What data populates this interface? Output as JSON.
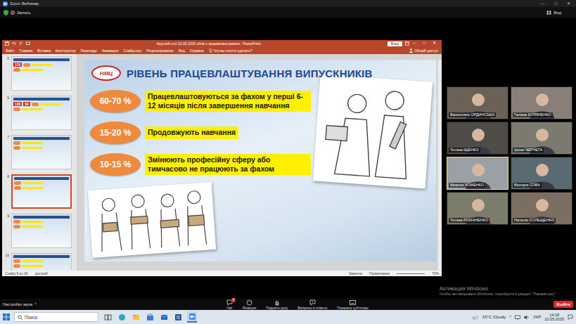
{
  "window": {
    "title": "Zoom Вебинар",
    "controls": [
      "—",
      "□",
      "✕"
    ]
  },
  "topbar": {
    "recording": "Запись",
    "view": "Вид"
  },
  "ppt": {
    "title": "Круглий стіл 22.05.2025 облік з працевлаштування - PowerPoint",
    "login": "Вход",
    "controls": [
      "—",
      "□",
      "✕"
    ],
    "menu": [
      "Файл",
      "Главная",
      "Вставка",
      "Конструктор",
      "Переходы",
      "Анимация",
      "Слайд-шоу",
      "Рецензирование",
      "Вид",
      "Справка"
    ],
    "search": "Что вы хотите сделать?",
    "share": "Общий доступ",
    "thumbnails": [
      {
        "number": "5",
        "selected": false,
        "texts": [
          "170"
        ]
      },
      {
        "number": "6",
        "selected": false,
        "texts": [
          "130",
          "69"
        ]
      },
      {
        "number": "7",
        "selected": false,
        "texts": []
      },
      {
        "number": "8",
        "selected": true,
        "texts": []
      },
      {
        "number": "9",
        "selected": false,
        "texts": []
      },
      {
        "number": "10",
        "selected": false,
        "texts": []
      }
    ],
    "slide": {
      "logo": "НМЦ",
      "title": "РІВЕНЬ ПРАЦЕВЛАШТУВАННЯ ВИПУСКНИКІВ",
      "rows": [
        {
          "value": "60-70 %",
          "text": "Працевлаштовуються за фахом у перші 6-12 місяців після завершення навчання"
        },
        {
          "value": "15-20 %",
          "text": "Продовжують навчання"
        },
        {
          "value": "10-15 %",
          "text": "Змінюють професійну сферу або тимчасово не працюють за фахом"
        }
      ]
    },
    "status": {
      "slide": "Слайд 8 из 26",
      "lang": "русский",
      "notes": "Заметки",
      "comments": "Примечания",
      "zoom": "73%"
    }
  },
  "participants": [
    {
      "name": "Валентина ОРДИНСЬКА",
      "active": false
    },
    {
      "name": "Галина КУЛЯНЕНКО",
      "active": false
    },
    {
      "name": "Тетяна ІЩЕНКО",
      "active": false
    },
    {
      "name": "Ірина ЧЕРНЕГА",
      "active": false
    },
    {
      "name": "Микола ХОМЕНКО",
      "active": true
    },
    {
      "name": "Вікторія СОВА",
      "active": false
    },
    {
      "name": "Тетяна РОМАНЕНКО",
      "active": false
    },
    {
      "name": "Наталія СОЛЕЩЕНКО",
      "active": false
    }
  ],
  "toolbar": {
    "audio": "Настройки звука",
    "caret": "^",
    "items": [
      {
        "label": "Чат",
        "badge": "9"
      },
      {
        "label": "Реакции",
        "badge": ""
      },
      {
        "label": "Поднять руку",
        "badge": ""
      },
      {
        "label": "Вопросы и ответы",
        "badge": ""
      },
      {
        "label": "Показать субтитры",
        "badge": ""
      }
    ],
    "leave": "Выйти"
  },
  "watermark": {
    "title": "Активация Windows",
    "text": "Чтобы активировать Windows, перейдите в раздел \"Параметры\"."
  },
  "taskbar": {
    "search": "Поиск",
    "apps": [
      {
        "selected": false
      },
      {
        "selected": false
      },
      {
        "selected": false
      },
      {
        "selected": false
      },
      {
        "selected": false
      },
      {
        "selected": false
      },
      {
        "selected": true
      }
    ],
    "weather": "15°C  Cloudy",
    "caret": "^",
    "lang": "УКР",
    "time": "14:18",
    "date": "22.05.2025"
  }
}
